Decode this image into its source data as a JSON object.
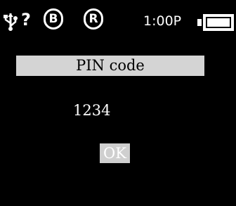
{
  "status": {
    "usb_icon": "usb-icon",
    "unknown_indicator": "?",
    "badge_b": "B",
    "badge_r": "R",
    "time": "1:00P",
    "battery_icon": "battery-icon"
  },
  "dialog": {
    "title": "PIN code",
    "pin_value": "1234",
    "ok_label": "OK"
  },
  "colors": {
    "background": "#000000",
    "title_bar": "#d4d4d4",
    "ok_button": "#cfcfcf",
    "text": "#ffffff"
  }
}
